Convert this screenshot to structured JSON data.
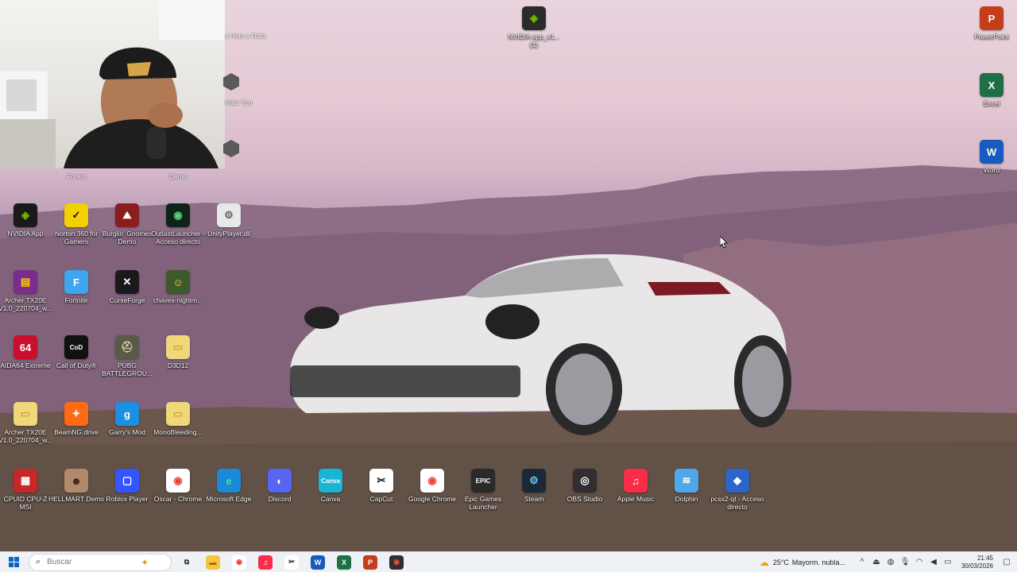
{
  "desktop": {
    "icons": [
      {
        "label": "NVIDIA app_v1... (1)",
        "color": "#2b2b2b",
        "glyph": "◈",
        "fg": "#76b900"
      },
      {
        "label": "PowerPoint",
        "color": "#c43e1c",
        "glyph": "P",
        "fg": "#ffffff"
      },
      {
        "label": "Excel",
        "color": "#1d7044",
        "glyph": "X",
        "fg": "#ffffff"
      },
      {
        "label": "Word",
        "color": "#185abd",
        "glyph": "W",
        "fg": "#ffffff"
      },
      {
        "label": "NVIDIA App",
        "color": "#1a1a1a",
        "glyph": "◈",
        "fg": "#76b900"
      },
      {
        "label": "Norton 360 for Gamers",
        "color": "#f2d100",
        "glyph": "✓",
        "fg": "#111111"
      },
      {
        "label": "Burglin' Gnomes Demo",
        "color": "#8a1d1d",
        "glyph": "⛰",
        "fg": "#ffffff"
      },
      {
        "label": "OutlastLauncher - Acceso directo",
        "color": "#0e2418",
        "glyph": "◉",
        "fg": "#5fcf7a"
      },
      {
        "label": "UnityPlayer.dll",
        "color": "#e8e8e8",
        "glyph": "⚙",
        "fg": "#666666"
      },
      {
        "label": "Archer TX20E V1.0_220704_w...",
        "color": "#7b2d8b",
        "glyph": "▤",
        "fg": "#ffcc00"
      },
      {
        "label": "Fortnite",
        "color": "#3ea6f0",
        "glyph": "F",
        "fg": "#ffffff"
      },
      {
        "label": "CurseForge",
        "color": "#1a1a1a",
        "glyph": "✕",
        "fg": "#ffffff"
      },
      {
        "label": "chaves-nightm...",
        "color": "#3d5a2a",
        "glyph": "☺",
        "fg": "#f0d060"
      },
      {
        "label": "AIDA64 Extreme",
        "color": "#c8102e",
        "glyph": "64",
        "fg": "#ffffff"
      },
      {
        "label": "Call of Duty®",
        "color": "#111111",
        "glyph": "CoD",
        "fg": "#ffffff"
      },
      {
        "label": "PUBG BATTLEGROU...",
        "color": "#5a5a4a",
        "glyph": "⛑",
        "fg": "#e0d0a0"
      },
      {
        "label": "D3D12",
        "color": "#f0d77a",
        "glyph": "▭",
        "fg": "#c9a93a"
      },
      {
        "label": "Archer TX20E V1.0_220704_w...",
        "color": "#f0d77a",
        "glyph": "▭",
        "fg": "#c9a93a"
      },
      {
        "label": "BeamNG.drive",
        "color": "#ff6a13",
        "glyph": "✦",
        "fg": "#ffffff"
      },
      {
        "label": "Garry's Mod",
        "color": "#1d8fe1",
        "glyph": "g",
        "fg": "#ffffff"
      },
      {
        "label": "MonoBleeding...",
        "color": "#f0d77a",
        "glyph": "▭",
        "fg": "#c9a93a"
      },
      {
        "label": "CPUID CPU-Z MSI",
        "color": "#c62828",
        "glyph": "▦",
        "fg": "#ffffff"
      },
      {
        "label": "HELLMART Demo",
        "color": "#b08a6a",
        "glyph": "☻",
        "fg": "#3a2010"
      },
      {
        "label": "Roblox Player",
        "color": "#3355ff",
        "glyph": "▢",
        "fg": "#ffffff"
      },
      {
        "label": "Oscar - Chrome",
        "color": "#ffffff",
        "glyph": "◉",
        "fg": "#ea4335"
      },
      {
        "label": "Microsoft Edge",
        "color": "#1b8ad8",
        "glyph": "e",
        "fg": "#4ae08a"
      },
      {
        "label": "Discord",
        "color": "#5865f2",
        "glyph": "◐",
        "fg": "#ffffff"
      },
      {
        "label": "Canva",
        "color": "#19b5d4",
        "glyph": "Canva",
        "fg": "#ffffff"
      },
      {
        "label": "CapCut",
        "color": "#ffffff",
        "glyph": "✂",
        "fg": "#111111"
      },
      {
        "label": "Google Chrome",
        "color": "#ffffff",
        "glyph": "◉",
        "fg": "#ea4335"
      },
      {
        "label": "Epic Games Launcher",
        "color": "#2a2a2a",
        "glyph": "EPIC",
        "fg": "#ffffff"
      },
      {
        "label": "Steam",
        "color": "#1b2838",
        "glyph": "⚙",
        "fg": "#66c0f4"
      },
      {
        "label": "OBS Studio",
        "color": "#302e31",
        "glyph": "◎",
        "fg": "#ffffff"
      },
      {
        "label": "Apple Music",
        "color": "#fa2d48",
        "glyph": "♫",
        "fg": "#ffffff"
      },
      {
        "label": "Dolphin",
        "color": "#4fa8e8",
        "glyph": "≋",
        "fg": "#ffffff"
      },
      {
        "label": "pcsx2-qt - Acceso directo",
        "color": "#2c64c8",
        "glyph": "◆",
        "fg": "#ffffff"
      }
    ],
    "partial_labels": [
      "s Hate y Data",
      "Hate You",
      "Forest",
      "Demo"
    ]
  },
  "taskbar": {
    "search_placeholder": "Buscar",
    "pinned": [
      {
        "name": "task-view-icon",
        "color": "transparent",
        "glyph": "⧉",
        "fg": "#333333"
      },
      {
        "name": "file-explorer-icon",
        "color": "#f5c542",
        "glyph": "▬",
        "fg": "#9a6d00"
      },
      {
        "name": "chrome-icon",
        "color": "#ffffff",
        "glyph": "◉",
        "fg": "#ea4335"
      },
      {
        "name": "apple-music-icon",
        "color": "#fa2d48",
        "glyph": "♫",
        "fg": "#ffffff"
      },
      {
        "name": "capcut-icon",
        "color": "#ffffff",
        "glyph": "✂",
        "fg": "#111111"
      },
      {
        "name": "word-icon",
        "color": "#185abd",
        "glyph": "W",
        "fg": "#ffffff"
      },
      {
        "name": "excel-icon",
        "color": "#1d7044",
        "glyph": "X",
        "fg": "#ffffff"
      },
      {
        "name": "powerpoint-icon",
        "color": "#c43e1c",
        "glyph": "P",
        "fg": "#ffffff"
      },
      {
        "name": "obs-recording-icon",
        "color": "#302e31",
        "glyph": "◉",
        "fg": "#e74c3c"
      }
    ],
    "weather": {
      "temp": "25°C",
      "condition": "Mayorm. nubla..."
    },
    "clock": {
      "time": "21:45",
      "date": "30/03/2026"
    }
  }
}
